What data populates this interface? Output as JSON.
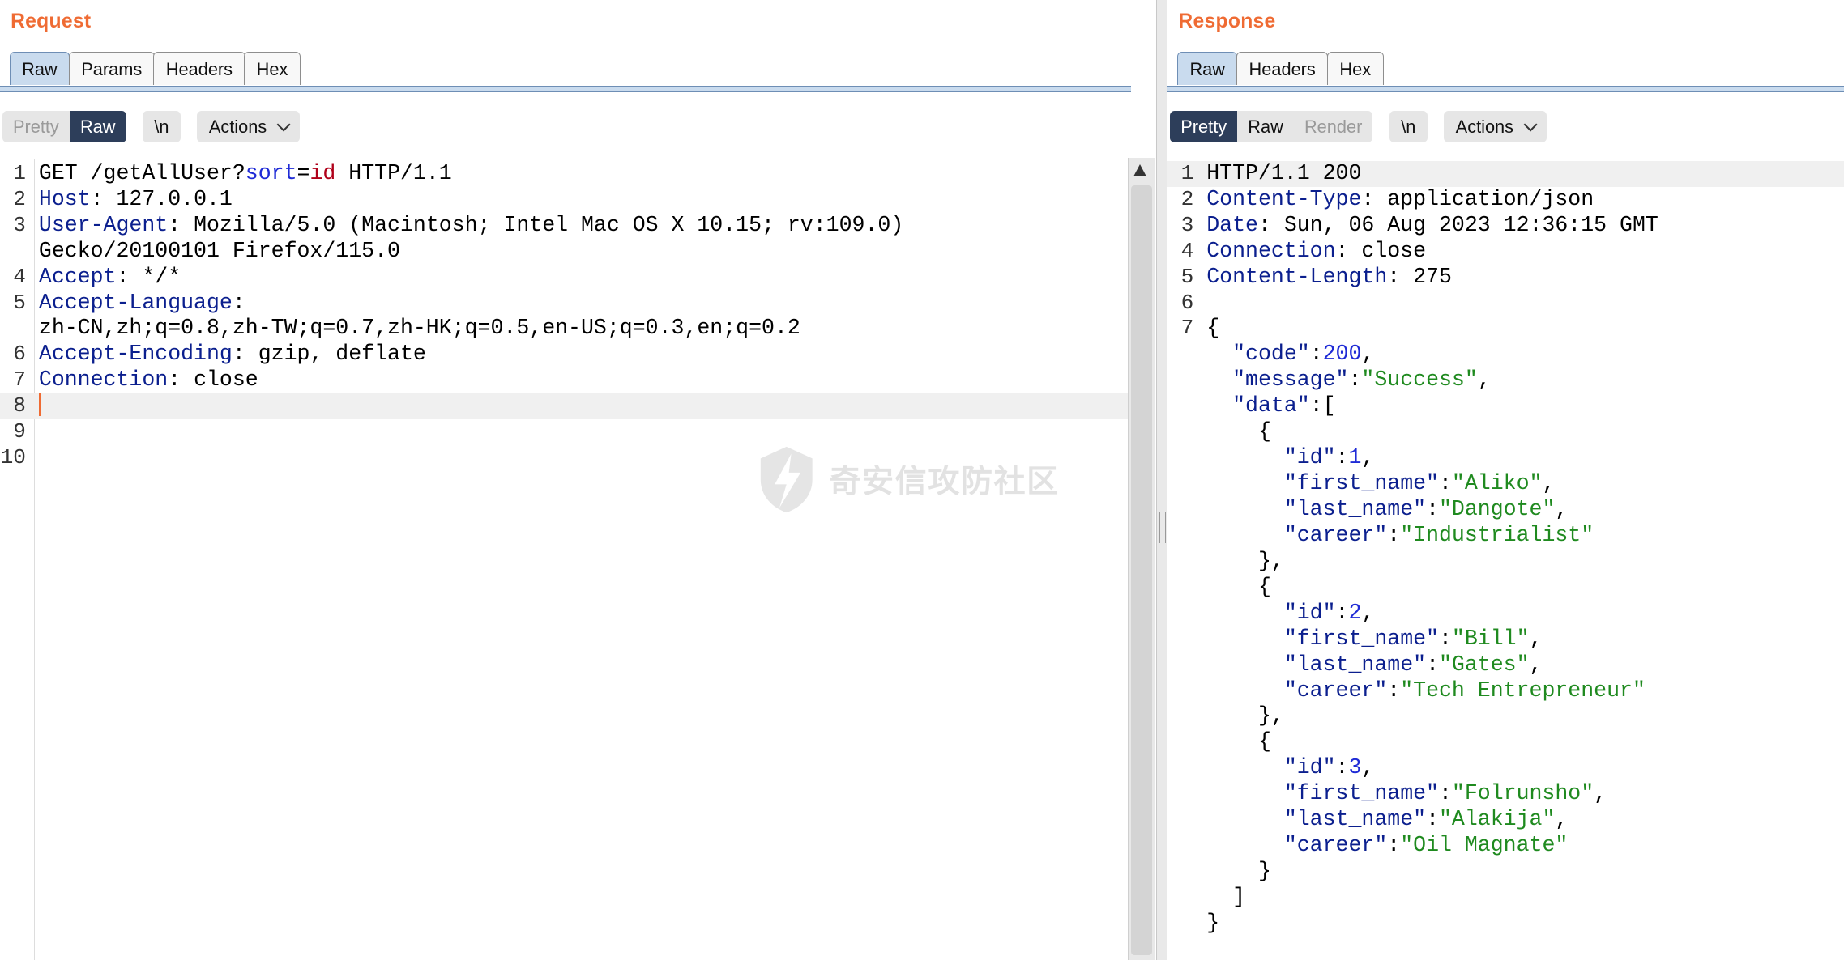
{
  "request": {
    "title": "Request",
    "tabs": [
      "Raw",
      "Params",
      "Headers",
      "Hex"
    ],
    "toolbar": {
      "pretty": "Pretty",
      "raw": "Raw",
      "newline": "\\n",
      "actions": "Actions"
    },
    "lines": [
      {
        "num": "1",
        "segs": [
          {
            "t": "GET /getAllUser?",
            "c": ""
          },
          {
            "t": "sort",
            "c": "n"
          },
          {
            "t": "=",
            "c": ""
          },
          {
            "t": "id",
            "c": "r"
          },
          {
            "t": " HTTP/1.1",
            "c": ""
          }
        ]
      },
      {
        "num": "2",
        "segs": [
          {
            "t": "Host",
            "c": "k"
          },
          {
            "t": ": 127.0.0.1",
            "c": ""
          }
        ]
      },
      {
        "num": "3",
        "segs": [
          {
            "t": "User-Agent",
            "c": "k"
          },
          {
            "t": ": Mozilla/5.0 (Macintosh; Intel Mac OS X 10.15; rv:109.0)",
            "c": ""
          }
        ]
      },
      {
        "num": "",
        "segs": [
          {
            "t": "Gecko/20100101 Firefox/115.0",
            "c": ""
          }
        ]
      },
      {
        "num": "4",
        "segs": [
          {
            "t": "Accept",
            "c": "k"
          },
          {
            "t": ": */*",
            "c": ""
          }
        ]
      },
      {
        "num": "5",
        "segs": [
          {
            "t": "Accept-Language",
            "c": "k"
          },
          {
            "t": ":",
            "c": ""
          }
        ]
      },
      {
        "num": "",
        "segs": [
          {
            "t": "zh-CN,zh;q=0.8,zh-TW;q=0.7,zh-HK;q=0.5,en-US;q=0.3,en;q=0.2",
            "c": ""
          }
        ]
      },
      {
        "num": "6",
        "segs": [
          {
            "t": "Accept-Encoding",
            "c": "k"
          },
          {
            "t": ": gzip, deflate",
            "c": ""
          }
        ]
      },
      {
        "num": "7",
        "segs": [
          {
            "t": "Connection",
            "c": "k"
          },
          {
            "t": ": close",
            "c": ""
          }
        ]
      },
      {
        "num": "8",
        "segs": [],
        "cursor": true
      },
      {
        "num": "9",
        "segs": []
      },
      {
        "num": "10",
        "segs": []
      }
    ]
  },
  "response": {
    "title": "Response",
    "tabs": [
      "Raw",
      "Headers",
      "Hex"
    ],
    "toolbar": {
      "pretty": "Pretty",
      "raw": "Raw",
      "render": "Render",
      "newline": "\\n",
      "actions": "Actions"
    },
    "lines": [
      {
        "num": "1",
        "segs": [
          {
            "t": "HTTP/1.1 200",
            "c": ""
          }
        ]
      },
      {
        "num": "2",
        "segs": [
          {
            "t": "Content-Type",
            "c": "k"
          },
          {
            "t": ": application/json",
            "c": ""
          }
        ]
      },
      {
        "num": "3",
        "segs": [
          {
            "t": "Date",
            "c": "k"
          },
          {
            "t": ": Sun, 06 Aug 2023 12:36:15 GMT",
            "c": ""
          }
        ]
      },
      {
        "num": "4",
        "segs": [
          {
            "t": "Connection",
            "c": "k"
          },
          {
            "t": ": close",
            "c": ""
          }
        ]
      },
      {
        "num": "5",
        "segs": [
          {
            "t": "Content-Length",
            "c": "k"
          },
          {
            "t": ": 275",
            "c": ""
          }
        ]
      },
      {
        "num": "6",
        "segs": []
      },
      {
        "num": "7",
        "segs": [
          {
            "t": "{",
            "c": ""
          }
        ]
      },
      {
        "num": "",
        "segs": [
          {
            "t": "  ",
            "c": ""
          },
          {
            "t": "\"code\"",
            "c": "k"
          },
          {
            "t": ":",
            "c": ""
          },
          {
            "t": "200",
            "c": "n"
          },
          {
            "t": ",",
            "c": ""
          }
        ]
      },
      {
        "num": "",
        "segs": [
          {
            "t": "  ",
            "c": ""
          },
          {
            "t": "\"message\"",
            "c": "k"
          },
          {
            "t": ":",
            "c": ""
          },
          {
            "t": "\"Success\"",
            "c": "s"
          },
          {
            "t": ",",
            "c": ""
          }
        ]
      },
      {
        "num": "",
        "segs": [
          {
            "t": "  ",
            "c": ""
          },
          {
            "t": "\"data\"",
            "c": "k"
          },
          {
            "t": ":[",
            "c": ""
          }
        ]
      },
      {
        "num": "",
        "segs": [
          {
            "t": "    {",
            "c": ""
          }
        ]
      },
      {
        "num": "",
        "segs": [
          {
            "t": "      ",
            "c": ""
          },
          {
            "t": "\"id\"",
            "c": "k"
          },
          {
            "t": ":",
            "c": ""
          },
          {
            "t": "1",
            "c": "n"
          },
          {
            "t": ",",
            "c": ""
          }
        ]
      },
      {
        "num": "",
        "segs": [
          {
            "t": "      ",
            "c": ""
          },
          {
            "t": "\"first_name\"",
            "c": "k"
          },
          {
            "t": ":",
            "c": ""
          },
          {
            "t": "\"Aliko\"",
            "c": "s"
          },
          {
            "t": ",",
            "c": ""
          }
        ]
      },
      {
        "num": "",
        "segs": [
          {
            "t": "      ",
            "c": ""
          },
          {
            "t": "\"last_name\"",
            "c": "k"
          },
          {
            "t": ":",
            "c": ""
          },
          {
            "t": "\"Dangote\"",
            "c": "s"
          },
          {
            "t": ",",
            "c": ""
          }
        ]
      },
      {
        "num": "",
        "segs": [
          {
            "t": "      ",
            "c": ""
          },
          {
            "t": "\"career\"",
            "c": "k"
          },
          {
            "t": ":",
            "c": ""
          },
          {
            "t": "\"Industrialist\"",
            "c": "s"
          }
        ]
      },
      {
        "num": "",
        "segs": [
          {
            "t": "    },",
            "c": ""
          }
        ]
      },
      {
        "num": "",
        "segs": [
          {
            "t": "    {",
            "c": ""
          }
        ]
      },
      {
        "num": "",
        "segs": [
          {
            "t": "      ",
            "c": ""
          },
          {
            "t": "\"id\"",
            "c": "k"
          },
          {
            "t": ":",
            "c": ""
          },
          {
            "t": "2",
            "c": "n"
          },
          {
            "t": ",",
            "c": ""
          }
        ]
      },
      {
        "num": "",
        "segs": [
          {
            "t": "      ",
            "c": ""
          },
          {
            "t": "\"first_name\"",
            "c": "k"
          },
          {
            "t": ":",
            "c": ""
          },
          {
            "t": "\"Bill\"",
            "c": "s"
          },
          {
            "t": ",",
            "c": ""
          }
        ]
      },
      {
        "num": "",
        "segs": [
          {
            "t": "      ",
            "c": ""
          },
          {
            "t": "\"last_name\"",
            "c": "k"
          },
          {
            "t": ":",
            "c": ""
          },
          {
            "t": "\"Gates\"",
            "c": "s"
          },
          {
            "t": ",",
            "c": ""
          }
        ]
      },
      {
        "num": "",
        "segs": [
          {
            "t": "      ",
            "c": ""
          },
          {
            "t": "\"career\"",
            "c": "k"
          },
          {
            "t": ":",
            "c": ""
          },
          {
            "t": "\"Tech Entrepreneur\"",
            "c": "s"
          }
        ]
      },
      {
        "num": "",
        "segs": [
          {
            "t": "    },",
            "c": ""
          }
        ]
      },
      {
        "num": "",
        "segs": [
          {
            "t": "    {",
            "c": ""
          }
        ]
      },
      {
        "num": "",
        "segs": [
          {
            "t": "      ",
            "c": ""
          },
          {
            "t": "\"id\"",
            "c": "k"
          },
          {
            "t": ":",
            "c": ""
          },
          {
            "t": "3",
            "c": "n"
          },
          {
            "t": ",",
            "c": ""
          }
        ]
      },
      {
        "num": "",
        "segs": [
          {
            "t": "      ",
            "c": ""
          },
          {
            "t": "\"first_name\"",
            "c": "k"
          },
          {
            "t": ":",
            "c": ""
          },
          {
            "t": "\"Folrunsho\"",
            "c": "s"
          },
          {
            "t": ",",
            "c": ""
          }
        ]
      },
      {
        "num": "",
        "segs": [
          {
            "t": "      ",
            "c": ""
          },
          {
            "t": "\"last_name\"",
            "c": "k"
          },
          {
            "t": ":",
            "c": ""
          },
          {
            "t": "\"Alakija\"",
            "c": "s"
          },
          {
            "t": ",",
            "c": ""
          }
        ]
      },
      {
        "num": "",
        "segs": [
          {
            "t": "      ",
            "c": ""
          },
          {
            "t": "\"career\"",
            "c": "k"
          },
          {
            "t": ":",
            "c": ""
          },
          {
            "t": "\"Oil Magnate\"",
            "c": "s"
          }
        ]
      },
      {
        "num": "",
        "segs": [
          {
            "t": "    }",
            "c": ""
          }
        ]
      },
      {
        "num": "",
        "segs": [
          {
            "t": "  ]",
            "c": ""
          }
        ]
      },
      {
        "num": "",
        "segs": [
          {
            "t": "}",
            "c": ""
          }
        ]
      }
    ]
  },
  "watermark": {
    "text": "奇安信攻防社区",
    "icon": "lightning-shield-logo"
  },
  "colors": {
    "title_orange": "#ef6b33",
    "tab_active": "#c9dbee",
    "toggle_selected": "#2d3e5a",
    "header_key": "#0b1f8e",
    "json_string": "#1f8a1f",
    "json_number": "#1f2bd6",
    "param_value": "#b0001a"
  }
}
